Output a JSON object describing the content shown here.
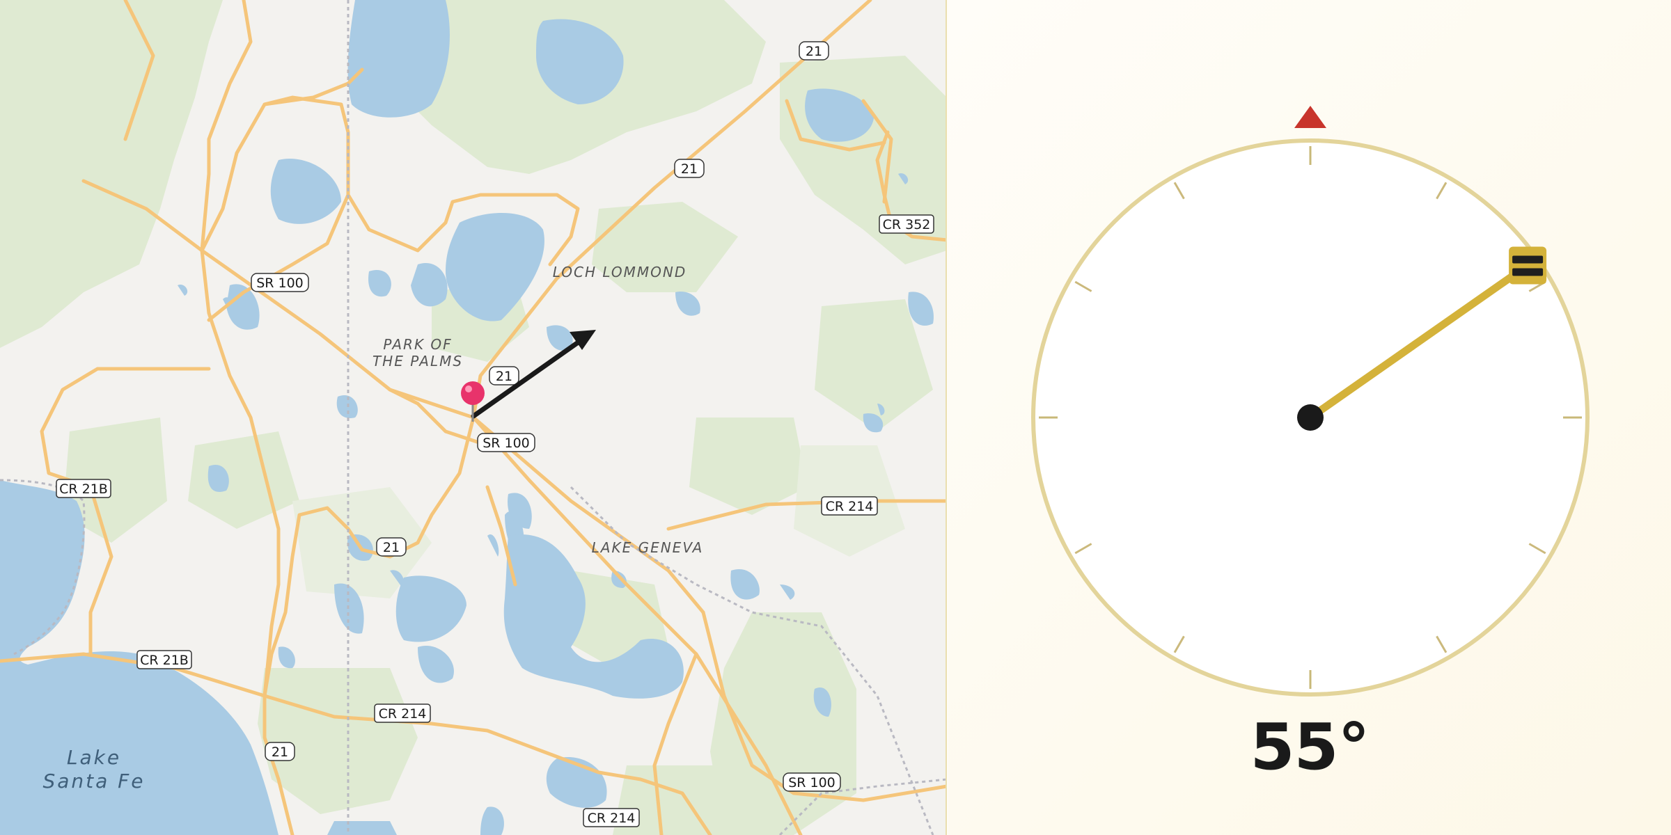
{
  "map": {
    "place_labels": [
      {
        "id": "loch-lommond",
        "text": "LOCH LOMMOND"
      },
      {
        "id": "park-of-the-palms-1",
        "text": "PARK OF"
      },
      {
        "id": "park-of-the-palms-2",
        "text": "THE PALMS"
      },
      {
        "id": "lake-geneva",
        "text": "LAKE GENEVA"
      },
      {
        "id": "lake-santa-fe-1",
        "text": "Lake"
      },
      {
        "id": "lake-santa-fe-2",
        "text": "Santa Fe"
      }
    ],
    "road_shields": [
      "21",
      "21",
      "CR 352",
      "SR 100",
      "21",
      "SR 100",
      "CR 21B",
      "21",
      "CR 214",
      "CR 21B",
      "CR 214",
      "21",
      "SR 100",
      "CR 214"
    ],
    "pin_icon": "map-pin-icon",
    "arrow_icon": "direction-arrow-icon"
  },
  "compass": {
    "bearing_deg": 55,
    "bearing_text": "55°",
    "north_marker_icon": "north-triangle-icon",
    "handle_icon": "drag-handle-icon",
    "colors": {
      "ring": "#e3d49a",
      "needle": "#d4b23a",
      "north": "#c8352c",
      "handle": "#1f1f1f",
      "pin": "#e8336b"
    }
  }
}
